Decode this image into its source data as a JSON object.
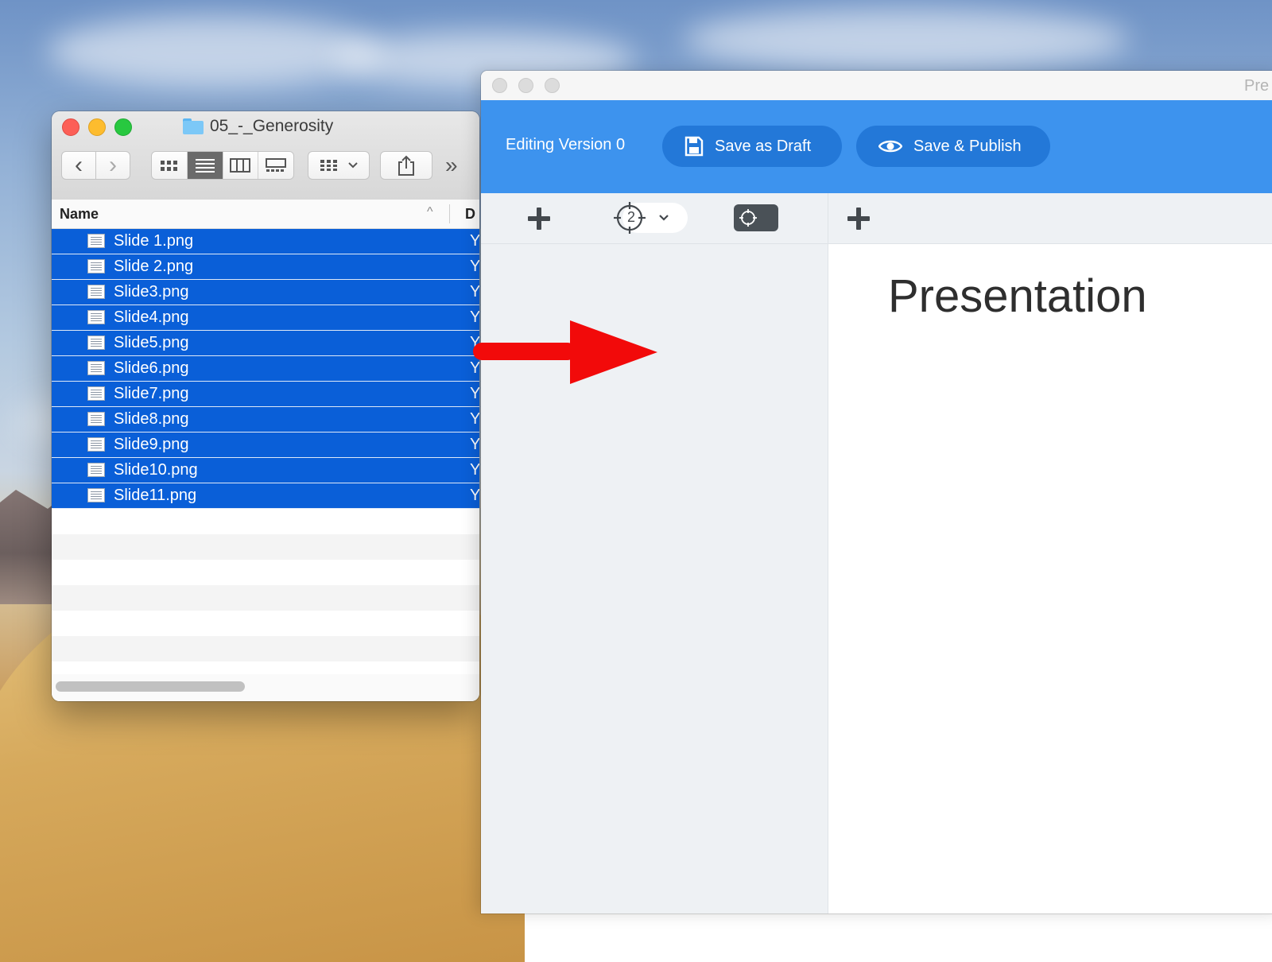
{
  "finder": {
    "title": "05_-_Generosity",
    "column_name": "Name",
    "column_second_partial": "D",
    "files": [
      {
        "name": "Slide 1.png",
        "col2": "Y"
      },
      {
        "name": "Slide 2.png",
        "col2": "Y"
      },
      {
        "name": "Slide3.png",
        "col2": "Y"
      },
      {
        "name": "Slide4.png",
        "col2": "Y"
      },
      {
        "name": "Slide5.png",
        "col2": "Y"
      },
      {
        "name": "Slide6.png",
        "col2": "Y"
      },
      {
        "name": "Slide7.png",
        "col2": "Y"
      },
      {
        "name": "Slide8.png",
        "col2": "Y"
      },
      {
        "name": "Slide9.png",
        "col2": "Y"
      },
      {
        "name": "Slide10.png",
        "col2": "Y"
      },
      {
        "name": "Slide11.png",
        "col2": "Y"
      }
    ],
    "more_glyph": "»",
    "back_glyph": "‹",
    "forward_glyph": "›",
    "sort_glyph": "^"
  },
  "editor": {
    "window_title_partial": "Pre",
    "editing_label": "Editing Version 0",
    "save_draft_label": "Save as Draft",
    "save_publish_label": "Save & Publish",
    "target_number": "2",
    "presentation_title": "Presentation"
  },
  "colors": {
    "selection": "#0a5fd8",
    "editor_bar": "#3d93ee",
    "pill": "#2378d8",
    "arrow": "#f20a0a"
  }
}
